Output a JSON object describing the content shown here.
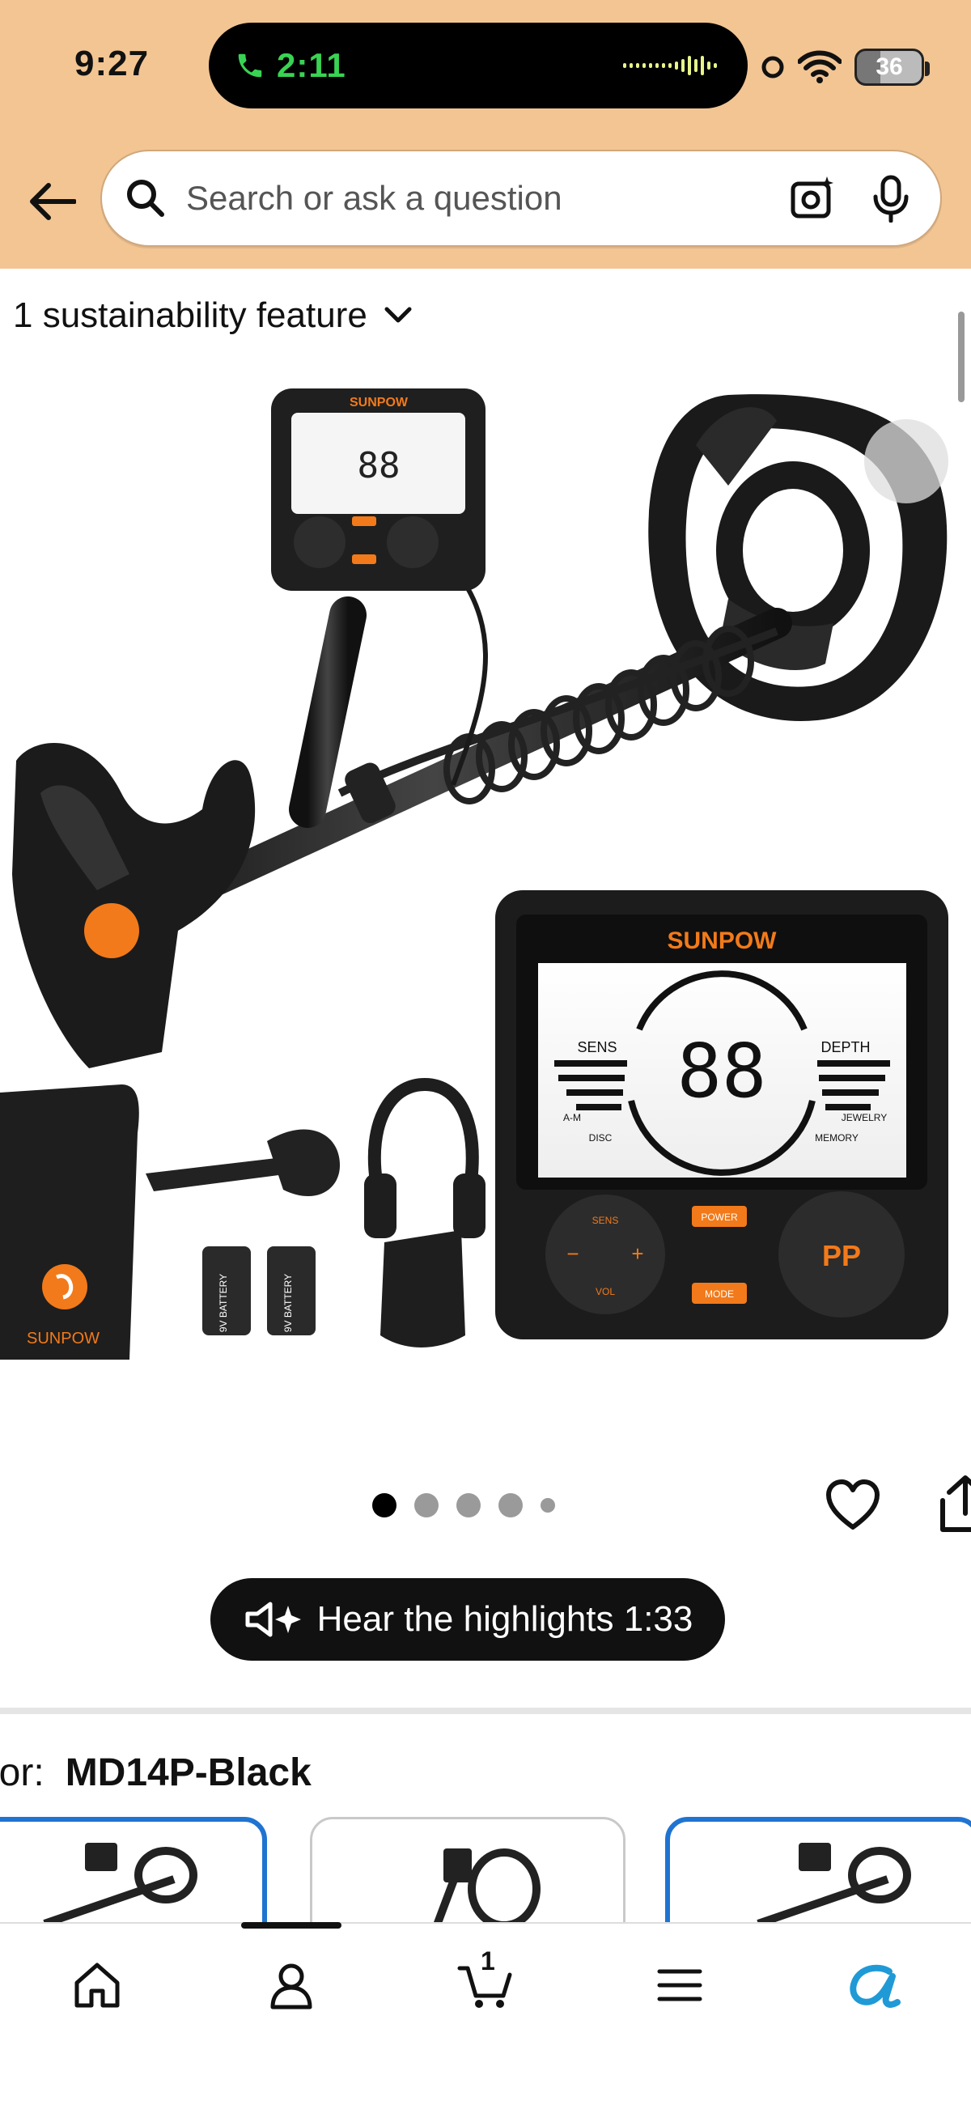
{
  "status": {
    "time": "9:27",
    "call_time": "2:11",
    "battery": "36"
  },
  "search": {
    "placeholder": "Search or ask a question"
  },
  "sustainability": {
    "label": "1 sustainability feature"
  },
  "product": {
    "brand": "SUNPOW",
    "display_digits": "88",
    "display_labels": {
      "sens": "SENS",
      "depth": "DEPTH",
      "am": "A-M",
      "disc": "DISC",
      "jewelry": "JEWELRY",
      "memory": "MEMORY"
    },
    "keypad": {
      "sens": "SENS",
      "vol": "VOL",
      "power": "POWER",
      "mode": "MODE",
      "pp": "PP"
    },
    "battery_text": "9V BATTERY"
  },
  "media": {
    "hear_label": "Hear the highlights 1:33"
  },
  "selection": {
    "color_label": "lor:",
    "color_value": "MD14P-Black"
  },
  "bottom_nav": {
    "cart_count": "1"
  }
}
